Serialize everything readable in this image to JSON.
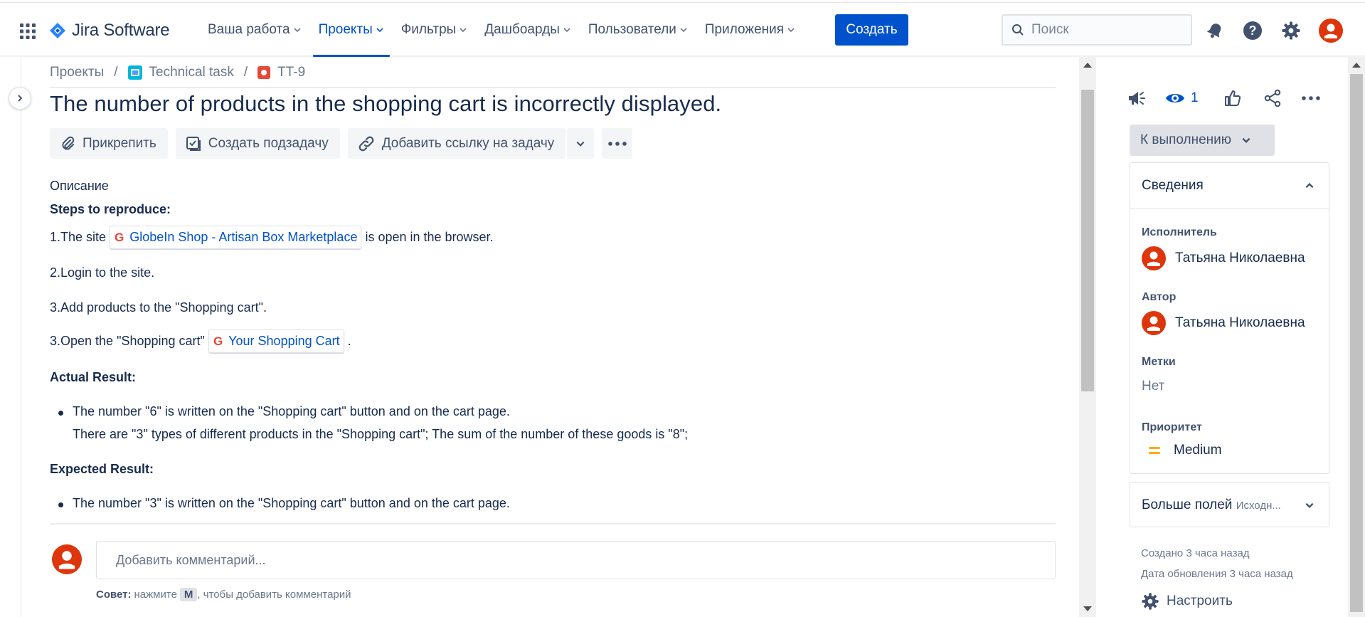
{
  "app": {
    "name": "Jira Software"
  },
  "nav": {
    "items": [
      {
        "label": "Ваша работа"
      },
      {
        "label": "Проекты"
      },
      {
        "label": "Фильтры"
      },
      {
        "label": "Дашбоарды"
      },
      {
        "label": "Пользователи"
      },
      {
        "label": "Приложения"
      }
    ],
    "create_label": "Создать",
    "search_placeholder": "Поиск"
  },
  "breadcrumb": {
    "projects": "Проекты",
    "project": "Technical task",
    "issue_key": "TT-9"
  },
  "issue": {
    "title": "The number of products in the shopping cart is incorrectly displayed.",
    "actions": {
      "attach": "Прикрепить",
      "create_subtask": "Создать подзадачу",
      "link_issue": "Добавить ссылку на задачу"
    },
    "description_label": "Описание",
    "description": {
      "steps_heading": "Steps to reproduce:",
      "step1_before": "1.The site",
      "step1_link": "GlobeIn Shop - Artisan Box Marketplace",
      "step1_after": "is open in the browser.",
      "step2": "2.Login to the site.",
      "step3": "3.Add products to the \"Shopping cart\".",
      "step4_before": "3.Open the \"Shopping cart\"",
      "step4_link": "Your Shopping Cart",
      "step4_after": ".",
      "actual_heading": "Actual Result:",
      "actual_line1": "The number \"6\" is written on the \"Shopping cart\" button and on the cart page.",
      "actual_line2": "There are \"3\" types of different products in the \"Shopping cart\"; The sum of the number of these goods is \"8\";",
      "expected_heading": "Expected Result:",
      "expected_line1": "The number \"3\" is written on the \"Shopping cart\" button and on the cart page."
    }
  },
  "comment": {
    "placeholder": "Добавить комментарий...",
    "tip_label": "Совет:",
    "tip_before": "нажмите",
    "tip_key": "M",
    "tip_after": ", чтобы добавить комментарий"
  },
  "sidebar": {
    "watchers_count": "1",
    "status": "К выполнению",
    "details_title": "Сведения",
    "assignee_label": "Исполнитель",
    "assignee": "Татьяна Николаевна",
    "reporter_label": "Автор",
    "reporter": "Татьяна Николаевна",
    "labels_label": "Метки",
    "labels_value": "Нет",
    "priority_label": "Приоритет",
    "priority_value": "Medium",
    "more_fields": "Больше полей",
    "more_fields_hint": "Исходн...",
    "created": "Создано 3 часа назад",
    "updated": "Дата обновления 3 часа назад",
    "configure": "Настроить"
  },
  "colors": {
    "brand": "#0052cc",
    "avatar": "#de350b",
    "priority_medium": "#ffab00",
    "text": "#172b4d"
  }
}
